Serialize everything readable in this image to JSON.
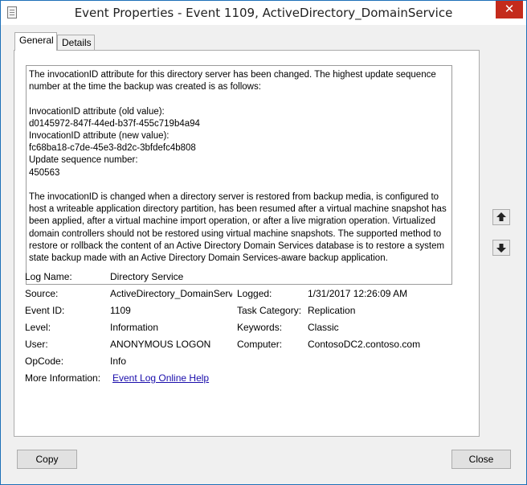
{
  "window": {
    "title": "Event Properties - Event 1109, ActiveDirectory_DomainService",
    "close_glyph": "✕"
  },
  "tabs": [
    {
      "label": "General"
    },
    {
      "label": "Details"
    }
  ],
  "description": "The invocationID attribute for this directory server has been changed. The highest update sequence number at the time the backup was created is as follows:\n\nInvocationID attribute (old value):\nd0145972-847f-44ed-b37f-455c719b4a94\nInvocationID attribute (new value):\nfc68ba18-c7de-45e3-8d2c-3bfdefc4b808\nUpdate sequence number:\n450563\n\nThe invocationID is changed when a directory server is restored from backup media, is configured to host a writeable application directory partition, has been resumed after a virtual machine snapshot has been applied, after a virtual machine import operation, or after a live migration operation. Virtualized domain controllers should not be restored using virtual machine snapshots. The supported method to restore or rollback the content of an Active Directory Domain Services database is to restore a system state backup made with an Active Directory Domain Services-aware backup application.",
  "fields": {
    "log_name": {
      "label": "Log Name:",
      "value": "Directory Service"
    },
    "source": {
      "label": "Source:",
      "value": "ActiveDirectory_DomainServ"
    },
    "logged": {
      "label": "Logged:",
      "value": "1/31/2017 12:26:09 AM"
    },
    "event_id": {
      "label": "Event ID:",
      "value": "1109"
    },
    "task_category": {
      "label": "Task Category:",
      "value": "Replication"
    },
    "level": {
      "label": "Level:",
      "value": "Information"
    },
    "keywords": {
      "label": "Keywords:",
      "value": "Classic"
    },
    "user": {
      "label": "User:",
      "value": "ANONYMOUS LOGON"
    },
    "computer": {
      "label": "Computer:",
      "value": "ContosoDC2.contoso.com"
    },
    "opcode": {
      "label": "OpCode:",
      "value": "Info"
    },
    "more_info": {
      "label": "More Information:",
      "value": "Event Log Online Help"
    }
  },
  "buttons": {
    "copy": "Copy",
    "close": "Close"
  },
  "icons": {
    "up": "arrow-up-icon",
    "down": "arrow-down-icon"
  }
}
